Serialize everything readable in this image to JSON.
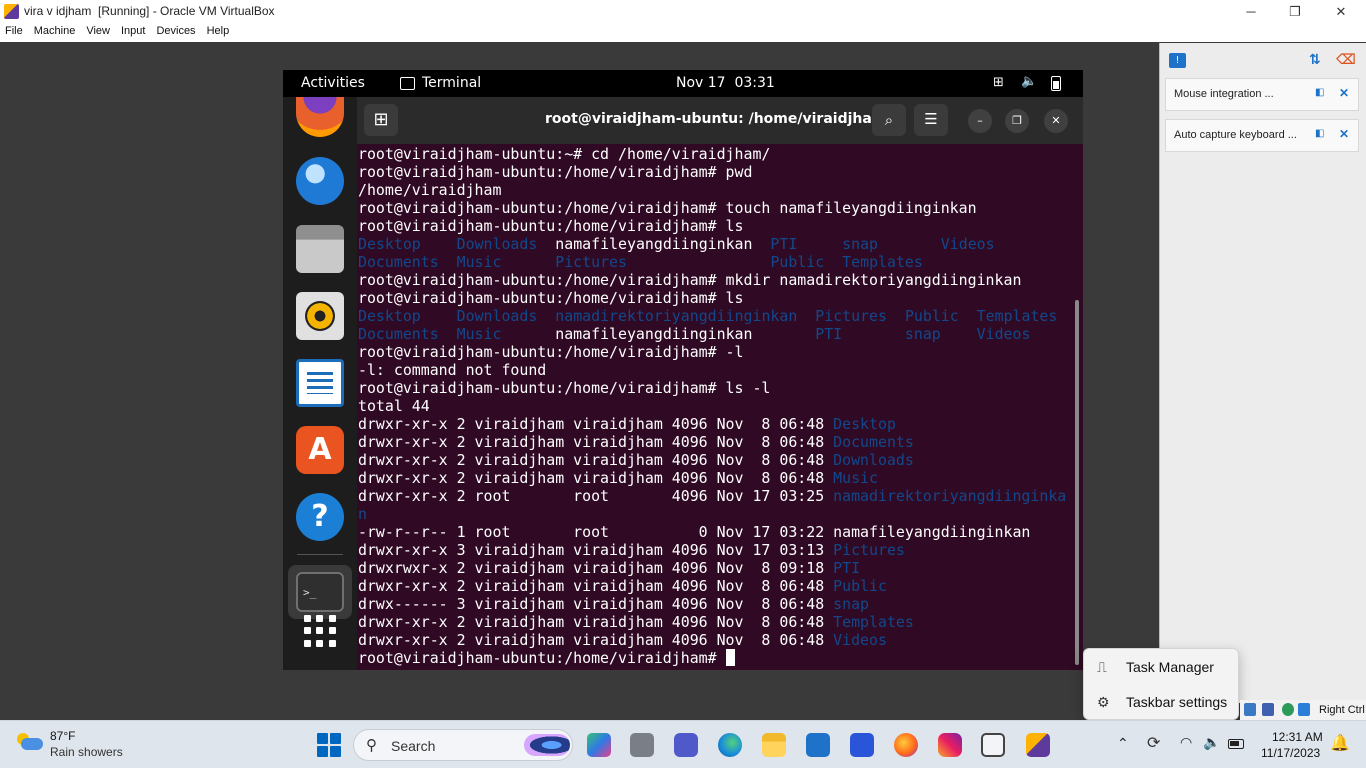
{
  "vbox": {
    "title": "vira v idjham  [Running] - Oracle VM VirtualBox",
    "menu": [
      "File",
      "Machine",
      "View",
      "Input",
      "Devices",
      "Help"
    ],
    "notifications": [
      {
        "text": "Mouse integration ..."
      },
      {
        "text": "Auto capture keyboard ..."
      }
    ],
    "status_host_key": "Right Ctrl"
  },
  "guest": {
    "topbar": {
      "activities": "Activities",
      "app_name": "Terminal",
      "clock": "Nov 17  03:31"
    },
    "terminal": {
      "title": "root@viraidjham-ubuntu: /home/viraidjham",
      "lines": [
        [
          {
            "t": "root@viraidjham-ubuntu:~# cd /home/viraidjham/"
          }
        ],
        [
          {
            "t": "root@viraidjham-ubuntu:/home/viraidjham# pwd"
          }
        ],
        [
          {
            "t": "/home/viraidjham"
          }
        ],
        [
          {
            "t": "root@viraidjham-ubuntu:/home/viraidjham# touch namafileyangdiinginkan"
          }
        ],
        [
          {
            "t": "root@viraidjham-ubuntu:/home/viraidjham# ls"
          }
        ],
        [
          {
            "t": "Desktop",
            "d": 1
          },
          {
            "t": "    "
          },
          {
            "t": "Downloads",
            "d": 1
          },
          {
            "t": "  namafileyangdiinginkan  "
          },
          {
            "t": "PTI",
            "d": 1
          },
          {
            "t": "     "
          },
          {
            "t": "snap",
            "d": 1
          },
          {
            "t": "       "
          },
          {
            "t": "Videos",
            "d": 1
          }
        ],
        [
          {
            "t": "Documents",
            "d": 1
          },
          {
            "t": "  "
          },
          {
            "t": "Music",
            "d": 1
          },
          {
            "t": "      "
          },
          {
            "t": "Pictures",
            "d": 1
          },
          {
            "t": "                "
          },
          {
            "t": "Public",
            "d": 1
          },
          {
            "t": "  "
          },
          {
            "t": "Templates",
            "d": 1
          }
        ],
        [
          {
            "t": "root@viraidjham-ubuntu:/home/viraidjham# mkdir namadirektoriyangdiinginkan"
          }
        ],
        [
          {
            "t": "root@viraidjham-ubuntu:/home/viraidjham# ls"
          }
        ],
        [
          {
            "t": "Desktop",
            "d": 1
          },
          {
            "t": "    "
          },
          {
            "t": "Downloads",
            "d": 1
          },
          {
            "t": "  "
          },
          {
            "t": "namadirektoriyangdiinginkan",
            "d": 1
          },
          {
            "t": "  "
          },
          {
            "t": "Pictures",
            "d": 1
          },
          {
            "t": "  "
          },
          {
            "t": "Public",
            "d": 1
          },
          {
            "t": "  "
          },
          {
            "t": "Templates",
            "d": 1
          }
        ],
        [
          {
            "t": "Documents",
            "d": 1
          },
          {
            "t": "  "
          },
          {
            "t": "Music",
            "d": 1
          },
          {
            "t": "      namafileyangdiinginkan       "
          },
          {
            "t": "PTI",
            "d": 1
          },
          {
            "t": "       "
          },
          {
            "t": "snap",
            "d": 1
          },
          {
            "t": "    "
          },
          {
            "t": "Videos",
            "d": 1
          }
        ],
        [
          {
            "t": "root@viraidjham-ubuntu:/home/viraidjham# -l"
          }
        ],
        [
          {
            "t": "-l: command not found"
          }
        ],
        [
          {
            "t": "root@viraidjham-ubuntu:/home/viraidjham# ls -l"
          }
        ],
        [
          {
            "t": "total 44"
          }
        ],
        [
          {
            "t": "drwxr-xr-x 2 viraidjham viraidjham 4096 Nov  8 06:48 "
          },
          {
            "t": "Desktop",
            "d": 1
          }
        ],
        [
          {
            "t": "drwxr-xr-x 2 viraidjham viraidjham 4096 Nov  8 06:48 "
          },
          {
            "t": "Documents",
            "d": 1
          }
        ],
        [
          {
            "t": "drwxr-xr-x 2 viraidjham viraidjham 4096 Nov  8 06:48 "
          },
          {
            "t": "Downloads",
            "d": 1
          }
        ],
        [
          {
            "t": "drwxr-xr-x 2 viraidjham viraidjham 4096 Nov  8 06:48 "
          },
          {
            "t": "Music",
            "d": 1
          }
        ],
        [
          {
            "t": "drwxr-xr-x 2 root       root       4096 Nov 17 03:25 "
          },
          {
            "t": "namadirektoriyangdiinginka",
            "d": 1
          }
        ],
        [
          {
            "t": "n",
            "d": 1
          }
        ],
        [
          {
            "t": "-rw-r--r-- 1 root       root          0 Nov 17 03:22 namafileyangdiinginkan"
          }
        ],
        [
          {
            "t": "drwxr-xr-x 3 viraidjham viraidjham 4096 Nov 17 03:13 "
          },
          {
            "t": "Pictures",
            "d": 1
          }
        ],
        [
          {
            "t": "drwxrwxr-x 2 viraidjham viraidjham 4096 Nov  8 09:18 "
          },
          {
            "t": "PTI",
            "d": 1
          }
        ],
        [
          {
            "t": "drwxr-xr-x 2 viraidjham viraidjham 4096 Nov  8 06:48 "
          },
          {
            "t": "Public",
            "d": 1
          }
        ],
        [
          {
            "t": "drwx------ 3 viraidjham viraidjham 4096 Nov  8 06:48 "
          },
          {
            "t": "snap",
            "d": 1
          }
        ],
        [
          {
            "t": "drwxr-xr-x 2 viraidjham viraidjham 4096 Nov  8 06:48 "
          },
          {
            "t": "Templates",
            "d": 1
          }
        ],
        [
          {
            "t": "drwxr-xr-x 2 viraidjham viraidjham 4096 Nov  8 06:48 "
          },
          {
            "t": "Videos",
            "d": 1
          }
        ]
      ],
      "prompt": "root@viraidjham-ubuntu:/home/viraidjham# "
    }
  },
  "context_menu": {
    "items": [
      "Task Manager",
      "Taskbar settings"
    ]
  },
  "taskbar": {
    "weather_temp": "87°F",
    "weather_desc": "Rain showers",
    "search_label": "Search",
    "time": "12:31 AM",
    "date": "11/17/2023"
  },
  "colors": {
    "terminal_bg": "#300a24",
    "directory": "#12488b",
    "ubuntu_orange": "#e95420",
    "windows_accent": "#0067c0"
  }
}
